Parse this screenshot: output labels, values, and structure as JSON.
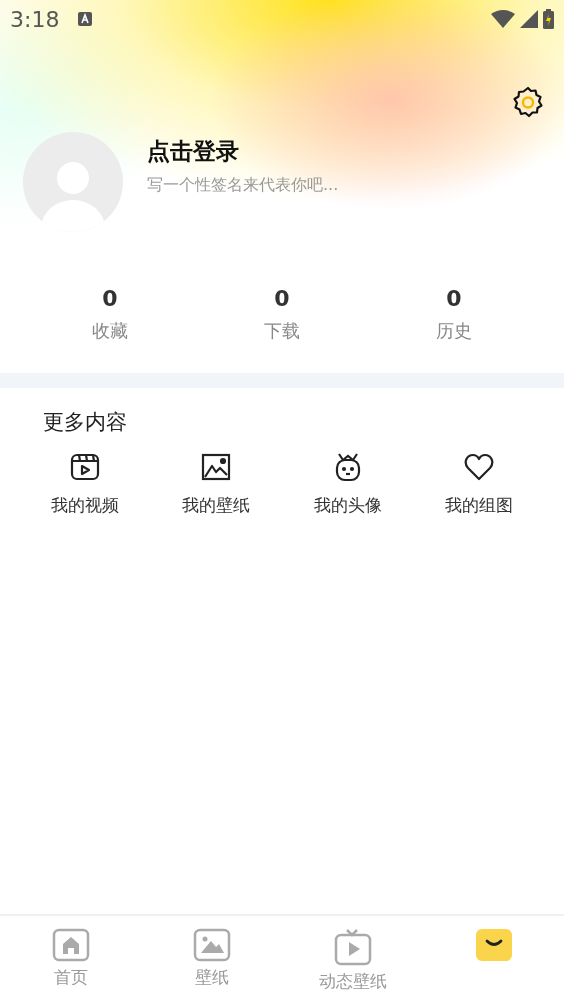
{
  "status_bar": {
    "time": "3:18"
  },
  "profile": {
    "title": "点击登录",
    "signature": "写一个性签名来代表你吧..."
  },
  "stats": [
    {
      "value": "0",
      "label": "收藏"
    },
    {
      "value": "0",
      "label": "下载"
    },
    {
      "value": "0",
      "label": "历史"
    }
  ],
  "more": {
    "title": "更多内容",
    "items": [
      {
        "kind": "video",
        "label": "我的视频"
      },
      {
        "kind": "wallpaper",
        "label": "我的壁纸"
      },
      {
        "kind": "avatar",
        "label": "我的头像"
      },
      {
        "kind": "heart",
        "label": "我的组图"
      }
    ]
  },
  "bottom_nav": [
    {
      "kind": "home",
      "label": "首页",
      "selected": false
    },
    {
      "kind": "wallpaper",
      "label": "壁纸",
      "selected": false
    },
    {
      "kind": "live",
      "label": "动态壁纸",
      "selected": false
    },
    {
      "kind": "me",
      "selected": true
    }
  ]
}
